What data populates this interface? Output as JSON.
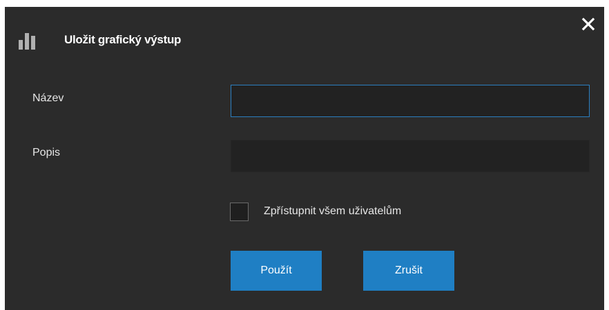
{
  "dialog": {
    "title": "Uložit grafický výstup",
    "title_icon": "bar-chart-icon",
    "close_icon": "close-icon"
  },
  "form": {
    "name_label": "Název",
    "name_value": "",
    "description_label": "Popis",
    "description_value": "",
    "share_checkbox_label": "Zpřístupnit všem uživatelům",
    "share_checked": false
  },
  "buttons": {
    "apply_label": "Použít",
    "cancel_label": "Zrušit"
  },
  "colors": {
    "background": "#2b2b2b",
    "input_background": "#222222",
    "focus_border": "#2b7fc1",
    "button_accent": "#1f7fc4",
    "text": "#e6e6e6"
  }
}
